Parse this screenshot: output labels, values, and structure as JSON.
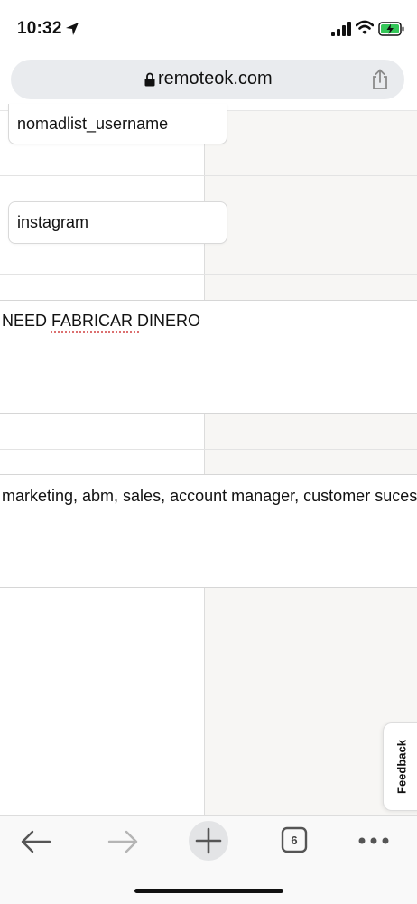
{
  "status_bar": {
    "time": "10:32"
  },
  "browser": {
    "url": "remoteok.com",
    "tab_count": "6",
    "feedback_label": "Feedback"
  },
  "form": {
    "nomadlist_field_value": "nomadlist_username",
    "instagram_field_value": "instagram",
    "textarea1_value": "NEED FABRICAR DINERO",
    "textarea2_value": "marketing, abm, sales, account manager, customer suces"
  },
  "colors": {
    "battery": "#35c759",
    "divider": "#e3e3e3",
    "grey_column": "#f7f6f4"
  },
  "icons": [
    "location-arrow-icon",
    "signal-icon",
    "wifi-icon",
    "battery-icon",
    "lock-icon",
    "share-icon",
    "back-arrow-icon",
    "forward-arrow-icon",
    "new-tab-icon",
    "tabs-icon",
    "more-icon"
  ]
}
